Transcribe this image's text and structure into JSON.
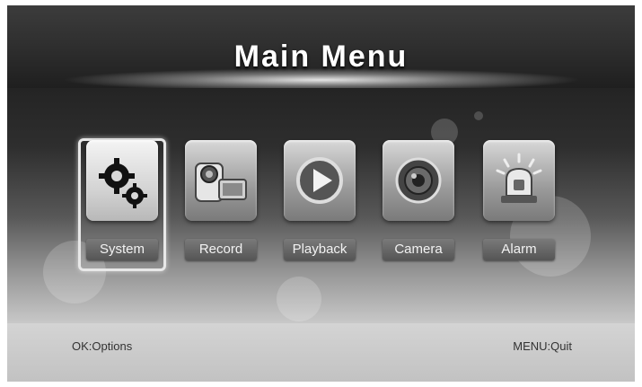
{
  "screen": {
    "title": "Main Menu",
    "selected": "System"
  },
  "menu": {
    "items": [
      {
        "label": "System",
        "icon": "gears-icon"
      },
      {
        "label": "Record",
        "icon": "camcorder-icon"
      },
      {
        "label": "Playback",
        "icon": "play-icon"
      },
      {
        "label": "Camera",
        "icon": "camera-lens-icon"
      },
      {
        "label": "Alarm",
        "icon": "siren-icon"
      }
    ]
  },
  "footer": {
    "left_hint": "OK:Options",
    "right_hint": "MENU:Quit"
  }
}
